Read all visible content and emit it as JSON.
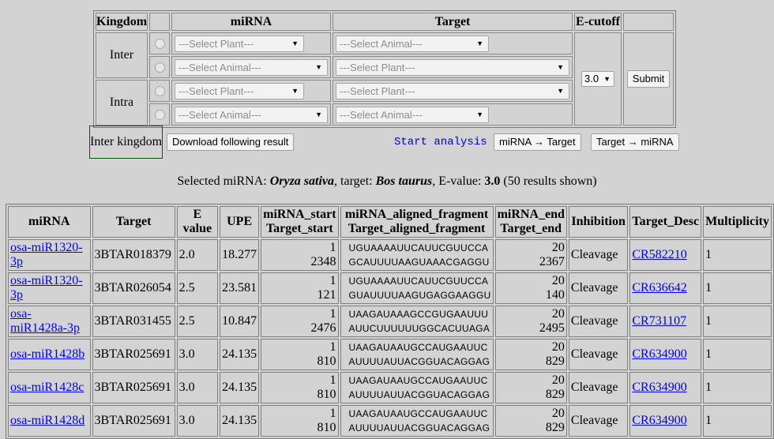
{
  "form": {
    "headers": {
      "kingdom": "Kingdom",
      "mirna": "miRNA",
      "target": "Target",
      "ecutoff": "E-cutoff"
    },
    "rows": [
      {
        "kingdom": "Inter",
        "mirna": "---Select Plant---",
        "target": "---Select Animal---"
      },
      {
        "mirna": "---Select Animal---",
        "target": "---Select Plant---"
      },
      {
        "kingdom": "Intra",
        "mirna": "---Select Plant---",
        "target": "---Select Plant---"
      },
      {
        "mirna": "---Select Animal---",
        "target": "---Select Animal---"
      }
    ],
    "ecutoff_value": "3.0",
    "submit_label": "Submit",
    "arrow": "▼"
  },
  "actions": {
    "mode": "Inter kingdom",
    "download_label": "Download following result",
    "start_analysis": "Start analysis",
    "mirna_to_target": "miRNA → Target",
    "target_to_mirna": "Target → miRNA"
  },
  "summary": {
    "prefix": "Selected miRNA: ",
    "mirna": "Oryza sativa",
    "target_label": ", target: ",
    "target": "Bos taurus",
    "evalue_label": ", E-value: ",
    "evalue": "3.0",
    "suffix": " (50 results shown)"
  },
  "results": {
    "headers": {
      "mirna": "miRNA",
      "target": "Target",
      "evalue": "E value",
      "upe": "UPE",
      "mirna_start": "miRNA_start",
      "target_start": "Target_start",
      "mirna_frag": "miRNA_aligned_fragment",
      "target_frag": "Target_aligned_fragment",
      "mirna_end": "miRNA_end",
      "target_end": "Target_end",
      "inhibition": "Inhibition",
      "target_desc": "Target_Desc",
      "multiplicity": "Multiplicity"
    },
    "rows": [
      {
        "mirna": "osa-miR1320-3p",
        "target": "3BTAR018379",
        "evalue": "2.0",
        "upe": "18.277",
        "mirna_start": "1",
        "target_start": "2348",
        "mirna_frag": "UGUAAAAUUCAUUCGUUCCA",
        "target_frag": "GCAUUUUAAGUAAACGAGGU",
        "mirna_end": "20",
        "target_end": "2367",
        "inhibition": "Cleavage",
        "desc": "CR582210",
        "mult": "1"
      },
      {
        "mirna": "osa-miR1320-3p",
        "target": "3BTAR026054",
        "evalue": "2.5",
        "upe": "23.581",
        "mirna_start": "1",
        "target_start": "121",
        "mirna_frag": "UGUAAAAUUCAUUCGUUCCA",
        "target_frag": "GUAUUUUAAGUGAGGAAGGU",
        "mirna_end": "20",
        "target_end": "140",
        "inhibition": "Cleavage",
        "desc": "CR636642",
        "mult": "1"
      },
      {
        "mirna": "osa-miR1428a-3p",
        "target": "3BTAR031455",
        "evalue": "2.5",
        "upe": "10.847",
        "mirna_start": "1",
        "target_start": "2476",
        "mirna_frag": "UAAGAUAAAGCCGUGAAUUU",
        "target_frag": "AUUCUUUUUUGGCACUUAGA",
        "mirna_end": "20",
        "target_end": "2495",
        "inhibition": "Cleavage",
        "desc": "CR731107",
        "mult": "1"
      },
      {
        "mirna": "osa-miR1428b",
        "target": "3BTAR025691",
        "evalue": "3.0",
        "upe": "24.135",
        "mirna_start": "1",
        "target_start": "810",
        "mirna_frag": "UAAGAUAAUGCCAUGAAUUC",
        "target_frag": "AUUUUAUUACGGUACAGGAG",
        "mirna_end": "20",
        "target_end": "829",
        "inhibition": "Cleavage",
        "desc": "CR634900",
        "mult": "1"
      },
      {
        "mirna": "osa-miR1428c",
        "target": "3BTAR025691",
        "evalue": "3.0",
        "upe": "24.135",
        "mirna_start": "1",
        "target_start": "810",
        "mirna_frag": "UAAGAUAAUGCCAUGAAUUC",
        "target_frag": "AUUUUAUUACGGUACAGGAG",
        "mirna_end": "20",
        "target_end": "829",
        "inhibition": "Cleavage",
        "desc": "CR634900",
        "mult": "1"
      },
      {
        "mirna": "osa-miR1428d",
        "target": "3BTAR025691",
        "evalue": "3.0",
        "upe": "24.135",
        "mirna_start": "1",
        "target_start": "810",
        "mirna_frag": "UAAGAUAAUGCCAUGAAUUC",
        "target_frag": "AUUUUAUUACGGUACAGGAG",
        "mirna_end": "20",
        "target_end": "829",
        "inhibition": "Cleavage",
        "desc": "CR634900",
        "mult": "1"
      }
    ]
  },
  "colors": {
    "background": "#d3d3d3",
    "link": "#0000ee",
    "start_analysis": "#0000cc",
    "mode_border": "#145214"
  }
}
